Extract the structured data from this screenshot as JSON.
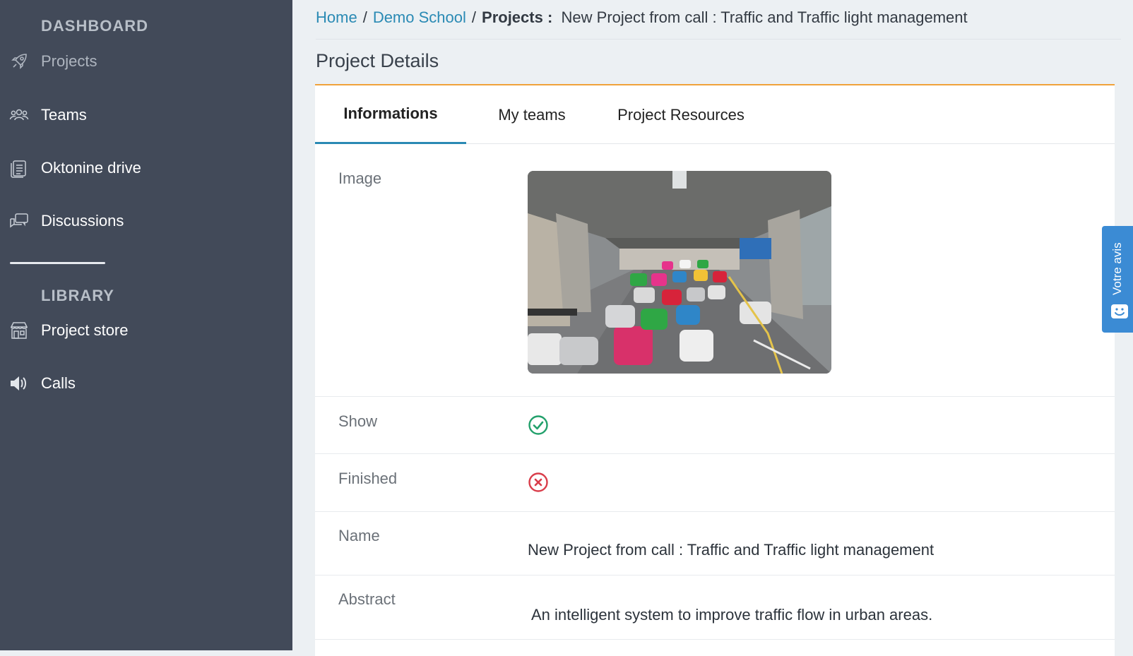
{
  "sidebar": {
    "sections": {
      "dashboard": "DASHBOARD",
      "library": "LIBRARY"
    },
    "items": [
      {
        "label": "Projects",
        "icon": "rocket-icon"
      },
      {
        "label": "Teams",
        "icon": "users-icon"
      },
      {
        "label": "Oktonine drive",
        "icon": "document-icon"
      },
      {
        "label": "Discussions",
        "icon": "chat-icon"
      },
      {
        "label": "Project store",
        "icon": "store-icon"
      },
      {
        "label": "Calls",
        "icon": "megaphone-icon"
      }
    ]
  },
  "breadcrumb": {
    "home": "Home",
    "school": "Demo School",
    "sep": "/",
    "projects": "Projects :",
    "current": "New Project from call : Traffic and Traffic light management"
  },
  "page_title": "Project Details",
  "tabs": [
    {
      "label": "Informations",
      "active": true
    },
    {
      "label": "My teams",
      "active": false
    },
    {
      "label": "Project Resources",
      "active": false
    }
  ],
  "details": {
    "image_label": "Image",
    "show_label": "Show",
    "show_value": "check-icon",
    "finished_label": "Finished",
    "finished_value": "x-circle-icon",
    "name_label": "Name",
    "name_value": "New Project from call : Traffic and Traffic light management",
    "abstract_label": "Abstract",
    "abstract_value": "An intelligent system to improve traffic flow in urban areas."
  },
  "feedback": {
    "label": "Votre avis"
  },
  "colors": {
    "sidebar_bg": "#424a59",
    "accent": "#2a8ab4",
    "card_top_border": "#f0a23a",
    "success": "#22a06b",
    "danger": "#d93d4a",
    "feedback_bg": "#3b8bd4"
  }
}
